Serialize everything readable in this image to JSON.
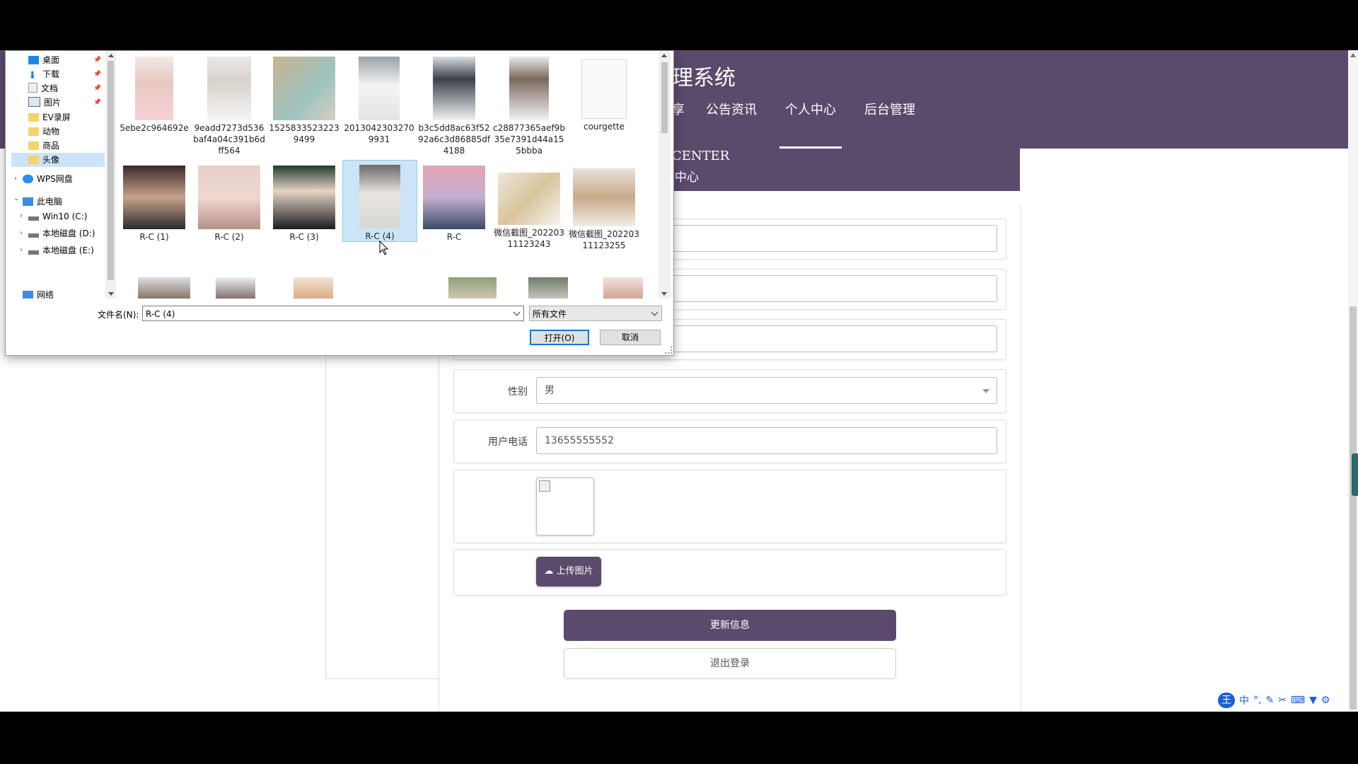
{
  "site": {
    "title": "理系统",
    "nav": [
      "享",
      "公告资讯",
      "个人中心",
      "后台管理"
    ],
    "active_nav": "个人中心",
    "banner_en": "CENTER",
    "banner_cn": "中心",
    "accent_color": "#5a4a6c"
  },
  "form": {
    "gender_label": "性别",
    "gender_value": "男",
    "phone_label": "用户电话",
    "phone_value": "13655555552",
    "upload_label": "上传图片",
    "update_button": "更新信息",
    "logout_button": "退出登录"
  },
  "dialog": {
    "tree": [
      {
        "label": "桌面",
        "icon": "desktop-icon",
        "pinned": true
      },
      {
        "label": "下载",
        "icon": "download-icon",
        "pinned": true
      },
      {
        "label": "文档",
        "icon": "document-icon",
        "pinned": true
      },
      {
        "label": "图片",
        "icon": "pictures-icon",
        "pinned": true
      },
      {
        "label": "EV录屏",
        "icon": "folder-icon"
      },
      {
        "label": "动物",
        "icon": "folder-icon"
      },
      {
        "label": "商品",
        "icon": "folder-icon"
      },
      {
        "label": "头像",
        "icon": "folder-icon",
        "selected": true
      },
      {
        "label": "WPS网盘",
        "icon": "cloud-icon"
      },
      {
        "label": "此电脑",
        "icon": "computer-icon"
      },
      {
        "label": "Win10 (C:)",
        "icon": "drive-icon"
      },
      {
        "label": "本地磁盘 (D:)",
        "icon": "drive-icon"
      },
      {
        "label": "本地磁盘 (E:)",
        "icon": "drive-icon"
      },
      {
        "label": "网络",
        "icon": "network-icon"
      }
    ],
    "files": [
      {
        "name": "5ebe2c964692e"
      },
      {
        "name": "9eadd7273d536baf4a04c391b6dff564"
      },
      {
        "name": "15258335232239499"
      },
      {
        "name": "20130423032709931"
      },
      {
        "name": "b3c5dd8ac63f5292a6c3d86885df4188"
      },
      {
        "name": "c28877365aef9b35e7391d44a155bbba"
      },
      {
        "name": "courgette"
      },
      {
        "name": "R-C (1)"
      },
      {
        "name": "R-C (2)"
      },
      {
        "name": "R-C (3)"
      },
      {
        "name": "R-C (4)",
        "selected": true
      },
      {
        "name": "R-C"
      },
      {
        "name": "微信截图_20220311123243"
      },
      {
        "name": "微信截图_20220311123255"
      }
    ],
    "file_name_label": "文件名(N):",
    "file_name_value": "R-C (4)",
    "file_type_value": "所有文件",
    "open_button": "打开(O)",
    "cancel_button": "取消"
  },
  "ime": {
    "logo": "王",
    "mode": "中"
  }
}
